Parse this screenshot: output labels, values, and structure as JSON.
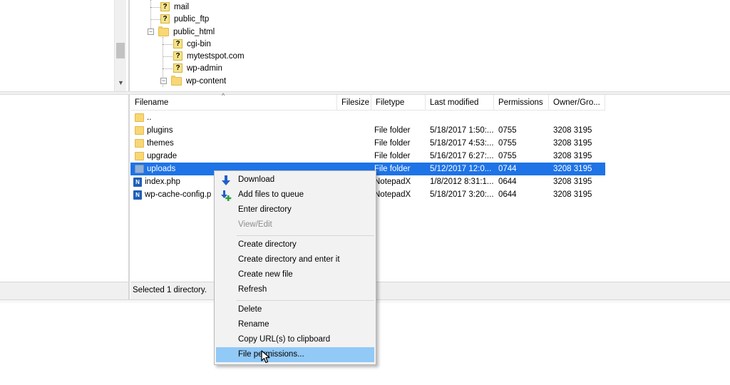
{
  "tree": {
    "items": [
      {
        "label": "mail",
        "icon": "question-icon"
      },
      {
        "label": "public_ftp",
        "icon": "question-icon"
      },
      {
        "label": "public_html",
        "icon": "folder-icon",
        "expander": "−"
      },
      {
        "label": "cgi-bin",
        "icon": "question-icon"
      },
      {
        "label": "mytestspot.com",
        "icon": "question-icon"
      },
      {
        "label": "wp-admin",
        "icon": "question-icon"
      },
      {
        "label": "wp-content",
        "icon": "folder-icon",
        "expander": "−"
      }
    ]
  },
  "list": {
    "columns": [
      "Filename",
      "Filesize",
      "Filetype",
      "Last modified",
      "Permissions",
      "Owner/Gro..."
    ],
    "rows": [
      {
        "name": "..",
        "icon": "folder-icon",
        "size": "",
        "type": "",
        "modified": "",
        "perm": "",
        "owner": ""
      },
      {
        "name": "plugins",
        "icon": "folder-icon",
        "size": "",
        "type": "File folder",
        "modified": "5/18/2017 1:50:...",
        "perm": "0755",
        "owner": "3208 3195"
      },
      {
        "name": "themes",
        "icon": "folder-icon",
        "size": "",
        "type": "File folder",
        "modified": "5/18/2017 4:53:...",
        "perm": "0755",
        "owner": "3208 3195"
      },
      {
        "name": "upgrade",
        "icon": "folder-icon",
        "size": "",
        "type": "File folder",
        "modified": "5/16/2017 6:27:...",
        "perm": "0755",
        "owner": "3208 3195"
      },
      {
        "name": "uploads",
        "icon": "folder-icon",
        "size": "",
        "type": "File folder",
        "modified": "5/12/2017 12:0...",
        "perm": "0744",
        "owner": "3208 3195",
        "selected": true
      },
      {
        "name": "index.php",
        "icon": "notepadx-icon",
        "size": "",
        "type": "NotepadX",
        "modified": "1/8/2012 8:31:1...",
        "perm": "0644",
        "owner": "3208 3195"
      },
      {
        "name": "wp-cache-config.p",
        "icon": "notepadx-icon",
        "size": "",
        "type": "NotepadX",
        "modified": "5/18/2017 3:20:...",
        "perm": "0644",
        "owner": "3208 3195"
      }
    ]
  },
  "status": {
    "text": "Selected 1 directory."
  },
  "context_menu": {
    "download": "Download",
    "add_to_queue": "Add files to queue",
    "enter_directory": "Enter directory",
    "view_edit": "View/Edit",
    "create_directory": "Create directory",
    "create_directory_enter": "Create directory and enter it",
    "create_new_file": "Create new file",
    "refresh": "Refresh",
    "delete": "Delete",
    "rename": "Rename",
    "copy_url": "Copy URL(s) to clipboard",
    "file_permissions": "File permissions..."
  },
  "colors": {
    "selection": "#1e73e6",
    "menu_hover": "#91c9f7",
    "folder": "#f8d775"
  }
}
